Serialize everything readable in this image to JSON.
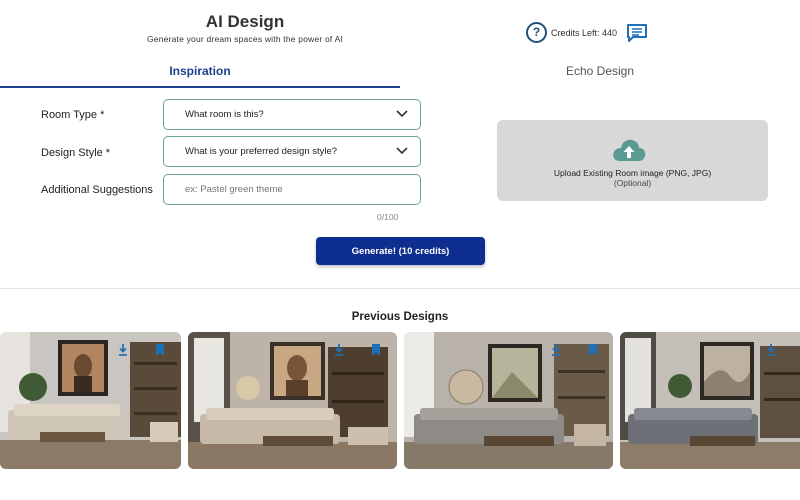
{
  "header": {
    "title": "AI Design",
    "subtitle": "Generate your dream spaces with the power of AI",
    "help_icon_text": "?",
    "credits_label": "Credits Left: 440",
    "icons": {
      "help": "help-circle-icon",
      "chat": "chat-message-icon"
    }
  },
  "tabs": [
    {
      "label": "Inspiration",
      "active": true
    },
    {
      "label": "Echo Design",
      "active": false
    }
  ],
  "form": {
    "room_type": {
      "label": "Room Type *",
      "value": "What room is this?"
    },
    "design_style": {
      "label": "Design Style *",
      "value": "What is your preferred design style?"
    },
    "suggestions": {
      "label": "Additional Suggestions",
      "placeholder": "ex: Pastel green theme",
      "value": "",
      "char_count": "0/100"
    }
  },
  "upload": {
    "title": "Upload Existing Room image (PNG, JPG)",
    "subtitle": "(Optional)",
    "icon": "cloud-upload-icon"
  },
  "generate_button": {
    "label": "Generate! (10 credits)"
  },
  "previous": {
    "title": "Previous Designs",
    "cards": [
      {
        "art": "portrait-woman-painting",
        "icons": [
          "download-icon",
          "bookmark-icon"
        ]
      },
      {
        "art": "portrait-woman-painting",
        "icons": [
          "download-icon",
          "bookmark-icon"
        ]
      },
      {
        "art": "forest-path-painting",
        "icons": [
          "download-icon",
          "bookmark-icon"
        ]
      },
      {
        "art": "abstract-painting",
        "icons": [
          "download-icon",
          "bookmark-icon"
        ]
      }
    ]
  },
  "colors": {
    "accent": "#1f3f8f",
    "button": "#0e2f8f",
    "field_border": "#6aa39a",
    "upload_bg": "#d8d8d8",
    "upload_icon": "#5a9a93",
    "icon_blue": "#1f6fb8"
  }
}
